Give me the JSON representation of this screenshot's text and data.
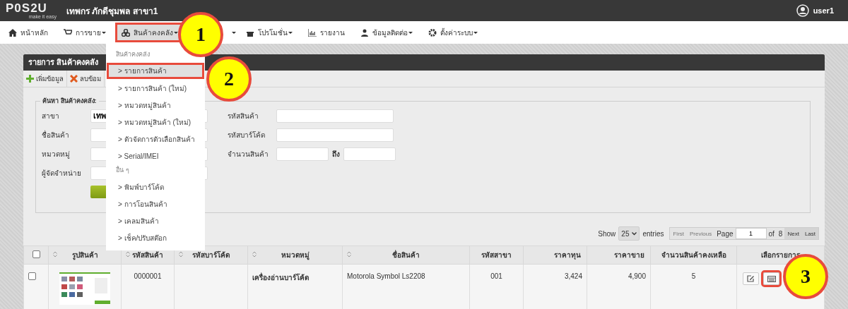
{
  "topbar": {
    "logo": "P0S2U",
    "tagline": "make it easy",
    "store": "เทพกร ภักดีชุมพล สาขา1",
    "user": "user1"
  },
  "nav": [
    {
      "kind": "home",
      "label": "หน้าหลัก",
      "caret": false,
      "selected": false,
      "highlighted": false
    },
    {
      "kind": "cart",
      "label": "การขาย",
      "caret": true,
      "selected": false,
      "highlighted": false
    },
    {
      "kind": "boxes",
      "label": "สินค้าคงคลัง",
      "caret": true,
      "selected": true,
      "highlighted": true
    },
    {
      "kind": "covered",
      "caret": true
    },
    {
      "kind": "gift",
      "label": "โปรโมชั่น",
      "caret": true,
      "selected": false,
      "highlighted": false
    },
    {
      "kind": "chart",
      "label": "รายงาน",
      "caret": false,
      "selected": false,
      "highlighted": false
    },
    {
      "kind": "users",
      "label": "ข้อมูลติดต่อ",
      "caret": true,
      "selected": false,
      "highlighted": false
    },
    {
      "kind": "gear",
      "label": "ตั้งค่าระบบ",
      "caret": true,
      "selected": false,
      "highlighted": false
    }
  ],
  "dropdown": [
    {
      "kind": "header",
      "label": "สินค้าคงคลัง"
    },
    {
      "kind": "item",
      "label": "> รายการสินค้า",
      "selected": true,
      "highlighted": true
    },
    {
      "kind": "item",
      "label": "> รายการสินค้า (ใหม่)",
      "selected": false,
      "highlighted": false
    },
    {
      "kind": "item",
      "label": "> หมวดหมู่สินค้า",
      "selected": false,
      "highlighted": false
    },
    {
      "kind": "item",
      "label": "> หมวดหมู่สินค้า (ใหม่)",
      "selected": false,
      "highlighted": false
    },
    {
      "kind": "item",
      "label": "> ตัวจัดการตัวเลือกสินค้า",
      "selected": false,
      "highlighted": false
    },
    {
      "kind": "item",
      "label": "> Serial/IMEI",
      "selected": false,
      "highlighted": false
    },
    {
      "kind": "header",
      "label": "อื่น ๆ"
    },
    {
      "kind": "item",
      "label": "> พิมพ์บาร์โค้ด",
      "selected": false,
      "highlighted": false
    },
    {
      "kind": "item",
      "label": "> การโอนสินค้า",
      "selected": false,
      "highlighted": false
    },
    {
      "kind": "item",
      "label": "> เคลมสินค้า",
      "selected": false,
      "highlighted": false
    },
    {
      "kind": "item",
      "label": "> เช็ค/ปรับสต๊อก",
      "selected": false,
      "highlighted": false
    }
  ],
  "panel": {
    "title": "รายการ สินค้าคงคลัง",
    "toolbar": [
      {
        "kind": "add",
        "label": "เพิ่มข้อมูล"
      },
      {
        "kind": "delete",
        "label": "ลบข้อม"
      }
    ],
    "search": {
      "legend": "ค้นหา สินค้าคงคลัง:",
      "left": [
        {
          "label": "สาขา",
          "value": "เทพ"
        },
        {
          "label": "ชื่อสินค้า"
        },
        {
          "label": "หมวดหมู่"
        },
        {
          "label": "ผู้จัดจำหน่าย"
        }
      ],
      "right": [
        {
          "label": "รหัสสินค้า"
        },
        {
          "label": "รหัสบาร์โค้ด"
        },
        {
          "label": "จำนวนสินค้า",
          "range_label": "ถึง"
        }
      ]
    }
  },
  "pager": {
    "show": "Show",
    "size": "25",
    "entries": "entries",
    "first": "First",
    "previous": "Previous",
    "page": "Page",
    "current": "1",
    "of": "of",
    "total": "8",
    "next": "Next",
    "last": "Last"
  },
  "table": {
    "select_all": false,
    "columns": [
      {
        "label": "รูปสินค้า",
        "sortable": true
      },
      {
        "label": "รหัสสินค้า",
        "sortable": true
      },
      {
        "label": "รหัสบาร์โค้ด",
        "sortable": true
      },
      {
        "label": "หมวดหมู่",
        "sortable": true
      },
      {
        "label": "ชื่อสินค้า",
        "sortable": true
      },
      {
        "label": "รหัสสาขา",
        "sortable": false
      },
      {
        "label": "ราคาทุน",
        "sortable": false
      },
      {
        "label": "ราคาขาย",
        "sortable": false
      },
      {
        "label": "จำนวนสินค้าคงเหลือ",
        "sortable": false
      },
      {
        "label": "เลือกรายการ",
        "sortable": false
      }
    ],
    "rows": [
      {
        "checked": false,
        "image": {
          "kind": "picture"
        },
        "code": "0000001",
        "category": "เครื่องอ่านบาร์โค้ด",
        "name": "Motorola Symbol Ls2208",
        "branch": "001",
        "cost": "3,424",
        "price": "4,900",
        "stock": "5",
        "actions": [
          {
            "kind": "edit",
            "highlighted": false
          },
          {
            "kind": "card",
            "highlighted": true
          }
        ]
      }
    ]
  },
  "callouts": [
    {
      "number": "1"
    },
    {
      "number": "2"
    },
    {
      "number": "3"
    }
  ]
}
